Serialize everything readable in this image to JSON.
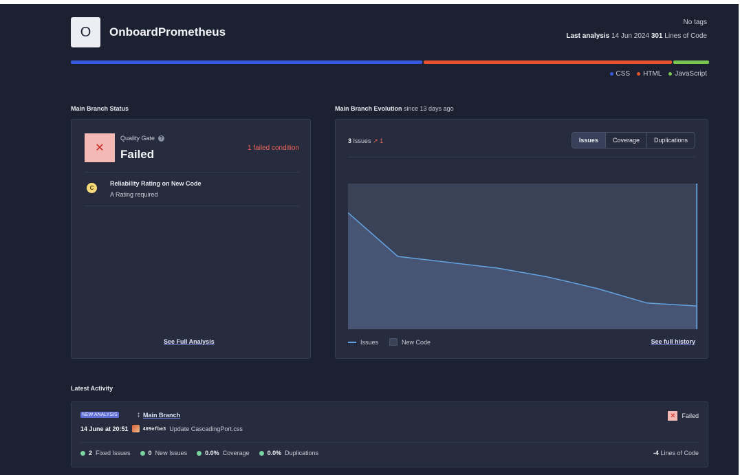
{
  "project": {
    "avatar_letter": "O",
    "name": "OnboardPrometheus",
    "tags": "No tags",
    "last_analysis_label": "Last analysis",
    "last_analysis_date": "14 Jun 2024",
    "lines_of_code": "301",
    "lines_of_code_label": "Lines of Code"
  },
  "languages": [
    {
      "name": "CSS",
      "share": 0.553,
      "color": "#3559e0"
    },
    {
      "name": "HTML",
      "share": 0.391,
      "color": "#e8532c"
    },
    {
      "name": "JavaScript",
      "share": 0.056,
      "color": "#7ac74f"
    }
  ],
  "main_branch_status": {
    "section_title": "Main Branch Status",
    "quality_gate_label": "Quality Gate",
    "status": "Failed",
    "failed_conditions": "1 failed condition",
    "condition": {
      "rating": "C",
      "title": "Reliability Rating on New Code",
      "subtitle": "A Rating required"
    },
    "see_full_analysis": "See Full Analysis"
  },
  "evolution": {
    "section_title": "Main Branch Evolution",
    "since": "since 13 days ago",
    "issues_count": "3",
    "issues_label": "Issues",
    "issues_delta": "↗ 1",
    "tabs": [
      "Issues",
      "Coverage",
      "Duplications"
    ],
    "active_tab": "Issues",
    "legend_issues": "Issues",
    "legend_new_code": "New Code",
    "see_full_history": "See full history"
  },
  "chart_data": {
    "type": "area",
    "series": [
      {
        "name": "Issues",
        "values": [
          4,
          2.5,
          2.3,
          2.1,
          1.8,
          1.4,
          0.9,
          0.8
        ]
      }
    ],
    "new_code_period": true,
    "xlabel": "",
    "ylabel": "",
    "color": "#62a3e0",
    "grid": false
  },
  "latest_activity": {
    "section_title": "Latest Activity",
    "badge": "NEW ANALYSIS",
    "branch": "Main Branch",
    "status": "Failed",
    "date": "14 June at 20:51",
    "commit_hash": "409efbe3",
    "commit_message": "Update CascadingPort.css",
    "stats": [
      {
        "value": "2",
        "label": "Fixed Issues"
      },
      {
        "value": "0",
        "label": "New Issues"
      },
      {
        "value": "0.0%",
        "label": "Coverage"
      },
      {
        "value": "0.0%",
        "label": "Duplications"
      }
    ],
    "loc_delta": "-4",
    "loc_delta_label": "Lines of Code"
  }
}
